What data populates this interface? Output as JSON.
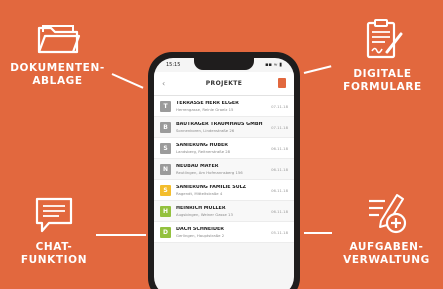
{
  "colors": {
    "background": "#e2683e",
    "badge_gray": "#9b9b9b",
    "badge_yellow": "#f3bd2c",
    "badge_green": "#93c13e"
  },
  "features": {
    "docs": {
      "label": "DOKUMENTEN-\nABLAGE",
      "icon": "folder-icon"
    },
    "forms": {
      "label": "DIGITALE\nFORMULARE",
      "icon": "signed-form-icon"
    },
    "chat": {
      "label": "CHAT-\nFUNKTION",
      "icon": "chat-bubble-icon"
    },
    "tasks": {
      "label": "AUFGABEN-\nVERWALTUNG",
      "icon": "add-task-icon"
    }
  },
  "phone": {
    "status_time": "15:15",
    "status_icons": "▪▪ ≈ ▮",
    "header_title": "PROJEKTE",
    "back_symbol": "‹"
  },
  "projects": [
    {
      "badge": "T",
      "color": "gray",
      "name": "TERRASSE HERR ELGER",
      "sub": "Herrengasse, Reinle Graelz 15",
      "date": "07.11.18"
    },
    {
      "badge": "B",
      "color": "gray",
      "name": "BAUTRÄGER TRAUMHAUS GMBH",
      "sub": "Sonnenkoren, Lindenstraße 26",
      "date": "07.11.18"
    },
    {
      "badge": "S",
      "color": "gray",
      "name": "SANIERUNG HUBER",
      "sub": "Landsberg, Reitnerstraße 28",
      "date": "06.11.18"
    },
    {
      "badge": "N",
      "color": "gray",
      "name": "NEUBAU MAYER",
      "sub": "Reutlingen, Am Hofmannsberg 156",
      "date": "06.11.18"
    },
    {
      "badge": "S",
      "color": "yellow",
      "name": "SANIERUNG FAMILIE SULZ",
      "sub": "Ragendt, Mitteltstraße 4",
      "date": "06.11.18"
    },
    {
      "badge": "H",
      "color": "green",
      "name": "HEINRICH MÜLLER",
      "sub": "Augsbingen, Weiner Gasse 13",
      "date": "06.11.18"
    },
    {
      "badge": "D",
      "color": "green",
      "name": "DACH SCHNEIDER",
      "sub": "Gerlingen, Hauptstraße 2",
      "date": "05.11.18"
    }
  ]
}
